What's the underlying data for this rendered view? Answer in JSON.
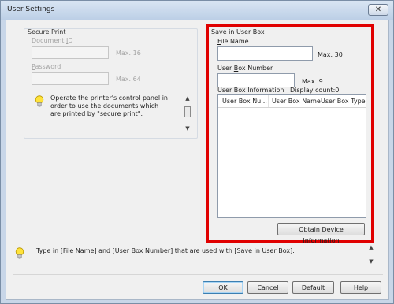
{
  "window": {
    "title": "User Settings",
    "close_glyph": "✕"
  },
  "secure_print": {
    "title": "Secure Print",
    "document_id_label": "Document ID",
    "document_id_value": "",
    "document_id_max": "Max. 16",
    "password_label": "Password",
    "password_value": "",
    "password_max": "Max. 64",
    "note": "Operate the printer's control panel in order to use the documents which are printed by \"secure print\"."
  },
  "save_in_user_box": {
    "title": "Save in User Box",
    "file_name_label": "File Name",
    "file_name_value": "",
    "file_name_max": "Max. 30",
    "user_box_number_label": "User Box Number",
    "user_box_number_value": "",
    "user_box_number_max": "Max. 9",
    "info_label": "User Box Information",
    "display_count": "Display count:0",
    "columns": [
      "User Box Nu...",
      "User Box Name",
      "User Box Type"
    ],
    "rows": [],
    "obtain_button": "Obtain Device Information"
  },
  "info_message": "Type in [File Name] and [User Box Number] that are used with [Save in User Box].",
  "buttons": {
    "ok": "OK",
    "cancel": "Cancel",
    "default": "Default",
    "help": "Help"
  },
  "colors": {
    "highlight_border": "#e00000",
    "dialog_background": "#f0f0f0"
  },
  "icons": {
    "hint": "lightbulb-icon",
    "close": "close-icon"
  }
}
